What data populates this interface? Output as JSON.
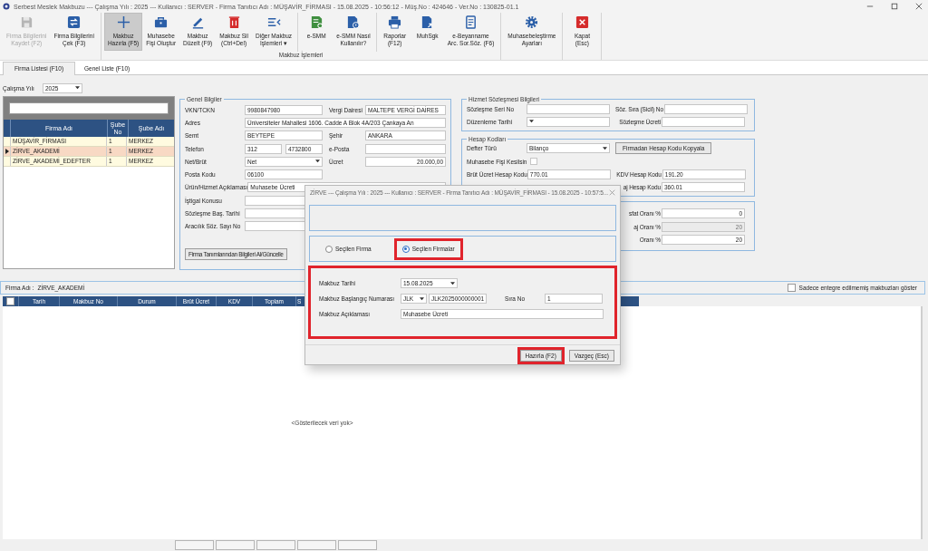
{
  "window": {
    "title": "Serbest Meslek Makbuzu  ---  Çalışma Yılı : 2025  ---  Kullanıcı : SERVER - Firma Tanıtıcı Adı : MÜŞAVİR_FİRMASI - 15.08.2025 - 10:56:12 - Müş.No : 424646 - Ver.No : 130825-01.1"
  },
  "toolbar": {
    "groups": [
      {
        "sections": [
          [
            {
              "lines": [
                "Firma Bilgilerini",
                "Kaydet (F2)"
              ],
              "disabled": true,
              "selected": false
            },
            {
              "lines": [
                "Firma Bilgilerini",
                "Çek (F3)"
              ],
              "disabled": false,
              "selected": false
            }
          ]
        ]
      },
      {
        "label": "Makbuz İşlemleri",
        "sections": [
          [
            {
              "lines": [
                "Makbuz",
                "Hazırla (F5)"
              ],
              "disabled": false,
              "selected": true
            },
            {
              "lines": [
                "Muhasebe",
                "Fişi Oluştur"
              ],
              "disabled": false,
              "selected": false
            },
            {
              "lines": [
                "Makbuz",
                "Düzelt (F9)"
              ],
              "disabled": false,
              "selected": false
            },
            {
              "lines": [
                "Makbuz Sil",
                "(Ctrl+Del)"
              ],
              "disabled": false,
              "selected": false
            },
            {
              "lines": [
                "Diğer Makbuz",
                "İşlemleri ▾"
              ],
              "disabled": false,
              "selected": false
            }
          ],
          [
            {
              "lines": [
                "e-SMM"
              ],
              "disabled": false,
              "selected": false
            },
            {
              "lines": [
                "e-SMM Nasıl",
                "Kullanılır?"
              ],
              "disabled": false,
              "selected": false
            }
          ],
          [
            {
              "lines": [
                "Raporlar",
                "(F12)"
              ],
              "disabled": false,
              "selected": false
            },
            {
              "lines": [
                "MuhSgk"
              ],
              "disabled": false,
              "selected": false
            },
            {
              "lines": [
                "e-Beyanname",
                "Arc. Sor.Söz. (F6)"
              ],
              "disabled": false,
              "selected": false
            }
          ]
        ]
      },
      {
        "sections": [
          [
            {
              "lines": [
                "Muhasebeleştirme",
                "Ayarları"
              ],
              "disabled": false,
              "selected": false
            }
          ]
        ]
      },
      {
        "sections": [
          [
            {
              "lines": [
                "Kapat",
                "(Esc)"
              ],
              "disabled": false,
              "selected": false
            }
          ]
        ]
      }
    ]
  },
  "tabs": [
    {
      "label": "Firma Listesi (F10)",
      "selected": true
    },
    {
      "label": "Genel Liste (F10)",
      "selected": false
    }
  ],
  "year": {
    "label": "Çalışma Yılı",
    "value": "2025"
  },
  "company_list": {
    "columns": [
      "Firma Adı",
      "Şube No",
      "Şube Adı"
    ],
    "rows": [
      {
        "cells": [
          "MÜŞAVİR_FİRMASI",
          "1",
          "MERKEZ"
        ],
        "selected": false
      },
      {
        "cells": [
          "ZİRVE_AKADEMİ",
          "1",
          "MERKEZ"
        ],
        "selected": true
      },
      {
        "cells": [
          "ZİRVE_AKADEMİ_EDEFTER",
          "1",
          "MERKEZ"
        ],
        "selected": false
      }
    ]
  },
  "general_info": {
    "title": "Genel Bilgiler",
    "rows": [
      {
        "fields": [
          {
            "label": "VKN/TCKN",
            "kind": "text",
            "value": "9980847980"
          },
          {
            "label": "Vergi Dairesi",
            "kind": "text",
            "value": "MALTEPE VERGİ DAİRES"
          }
        ]
      },
      {
        "fields": [
          {
            "label": "Adres",
            "kind": "wide",
            "value": "Üniversiteler Mahallesi 1606. Cadde A Blok 4A/203 Çankaya An"
          }
        ]
      },
      {
        "fields": [
          {
            "label": "Semt",
            "kind": "text",
            "value": "BEYTEPE"
          },
          {
            "label": "Şehir",
            "kind": "text",
            "value": "ANKARA"
          }
        ]
      },
      {
        "fields": [
          {
            "label": "Telefon",
            "kind": "phone",
            "parts": [
              "312",
              "4732800"
            ]
          },
          {
            "label": "e-Posta",
            "kind": "text"
          }
        ]
      },
      {
        "fields": [
          {
            "label": "Net/Brüt",
            "kind": "select",
            "value": "Net"
          },
          {
            "label": "Ücret",
            "kind": "amount",
            "value": "20.000,00"
          }
        ]
      },
      {
        "fields": [
          {
            "label": "Posta Kodu",
            "kind": "text",
            "value": "06100"
          }
        ]
      },
      {
        "fields": [
          {
            "label": "Ürün/Hizmet Açıklaması",
            "kind": "wide",
            "value": "Muhasebe Ücreti"
          }
        ]
      },
      {
        "fields": [
          {
            "label": "İştigal Konusu",
            "kind": "wide"
          }
        ]
      },
      {
        "fields": [
          {
            "label": "Sözleşme Baş. Tarihi",
            "kind": "wide"
          }
        ]
      },
      {
        "fields": [
          {
            "label": "Aracılık Söz. Sayı No",
            "kind": "wide"
          }
        ]
      }
    ],
    "button": "Firma Tanımlarından Bilgileri Al/Güncelle"
  },
  "contract_info": {
    "title": "Hizmet Sözleşmesi Bilgileri",
    "rows": [
      {
        "fields": [
          {
            "label": "Sözleşme Seri No",
            "kind": "text"
          },
          {
            "label": "Söz. Sıra (Sicil) No",
            "kind": "text"
          }
        ]
      },
      {
        "fields": [
          {
            "label": "Düzenleme Tarihi",
            "kind": "select"
          },
          {
            "label": "Sözleşme Ücreti",
            "kind": "text"
          }
        ]
      }
    ]
  },
  "account_codes": {
    "title": "Hesap Kodları",
    "rows": [
      {
        "fields": [
          {
            "label": "Defter Türü",
            "kind": "select",
            "value": "Bilanço"
          },
          {
            "label": "Firmadan Hesap Kodu Kopyala",
            "kind": "button"
          }
        ]
      },
      {
        "fields": [
          {
            "label": "Muhasebe Fişi Kesilsin",
            "kind": "checkbox",
            "checked": false
          }
        ]
      },
      {
        "fields": [
          {
            "label": "Brüt Ücret Hesap Kodu",
            "kind": "text",
            "value": "770.01"
          },
          {
            "label": "KDV Hesap Kodu",
            "kind": "text",
            "value": "191.20"
          }
        ]
      },
      {
        "fields": [
          {
            "kind": "blank"
          },
          {
            "label": "aj Hesap Kodu",
            "kind": "text",
            "value": "360.01"
          }
        ]
      }
    ]
  },
  "rates": {
    "rows": [
      {
        "fields": [
          {
            "kind": "blank"
          },
          {
            "label": "sfat Oranı %",
            "kind": "amount",
            "value": "0",
            "disabled": false
          }
        ]
      },
      {
        "fields": [
          {
            "kind": "blank"
          },
          {
            "label": "aj Oranı %",
            "kind": "amount",
            "value": "20",
            "disabled": true
          }
        ]
      },
      {
        "fields": [
          {
            "kind": "blank"
          },
          {
            "label": "Oranı %",
            "kind": "amount",
            "value": "20",
            "disabled": false
          }
        ]
      }
    ]
  },
  "receipts": {
    "firm_label": "Firma Adı :",
    "firm_name": "ZİRVE_AKADEMİ",
    "filter": {
      "label": "Sadece entegre edilmemiş makbuzları göster",
      "checked": false
    },
    "select_all": {
      "checked": false
    },
    "columns": [
      "Tarih",
      "Makbuz No",
      "Durum",
      "Brüt Ücret",
      "KDV",
      "Toplam",
      "S"
    ],
    "empty_text": "<Gösterilecek veri yok>"
  },
  "dialog": {
    "title": "ZİRVE --- Çalışma Yılı : 2025 --- Kullanıcı : SERVER - Firma Tanıtıcı Adı : MÜŞAVİR_FİRMASI - 15.08.2025 - 10:57:5...",
    "options": [
      {
        "label": "Seçilen Firma",
        "selected": false,
        "highlighted": false
      },
      {
        "label": "Seçilen Firmalar",
        "selected": true,
        "highlighted": true
      }
    ],
    "form": {
      "highlighted": true,
      "rows": [
        {
          "fields": [
            {
              "label": "Makbuz Tarihi",
              "kind": "select",
              "value": "15.08.2025"
            }
          ]
        },
        {
          "fields": [
            {
              "label": "Makbuz Başlangıç Numarası",
              "kind": "combo",
              "value": "JLK"
            },
            {
              "kind": "text",
              "value": "JLK2025000000001"
            },
            {
              "label": "Sıra No",
              "kind": "text",
              "value": "1"
            }
          ]
        },
        {
          "fields": [
            {
              "label": "Makbuz Açıklaması",
              "kind": "wide",
              "value": "Muhasebe Ücreti"
            }
          ]
        }
      ]
    },
    "buttons": [
      {
        "label": "Hazırla (F2)",
        "highlighted": true
      },
      {
        "label": "Vazgeç (Esc)",
        "highlighted": false
      }
    ]
  }
}
